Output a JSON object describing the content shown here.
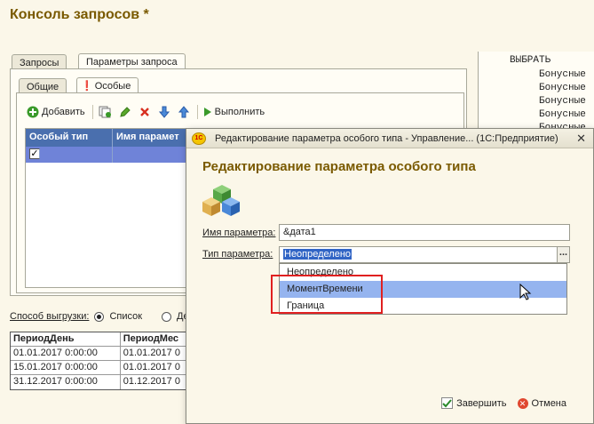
{
  "app": {
    "title": "Консоль запросов *"
  },
  "main_tabs": [
    {
      "label": "Запросы",
      "active": false
    },
    {
      "label": "Параметры запроса",
      "active": true
    }
  ],
  "sub_tabs": [
    {
      "label": "Общие",
      "active": false
    },
    {
      "label": "Особые",
      "active": true,
      "icon": "exclamation-icon"
    }
  ],
  "toolbar": {
    "add_label": "Добавить",
    "execute_label": "Выполнить",
    "icons": [
      "add-icon",
      "copy-icon",
      "edit-pencil-icon",
      "delete-icon",
      "move-down-icon",
      "move-up-icon",
      "play-icon"
    ]
  },
  "params_grid": {
    "columns": [
      "Особый тип",
      "Имя парамет"
    ],
    "rows": [
      {
        "special_type": true,
        "name": ""
      }
    ]
  },
  "code_panel": {
    "lines": [
      "ВЫБРАТЬ",
      "Бонусные",
      "Бонусные",
      "Бонусные",
      "Бонусные",
      "Бонусные"
    ]
  },
  "export": {
    "label": "Способ выгрузки:",
    "options": [
      {
        "label": "Список",
        "selected": true
      },
      {
        "label": "Де",
        "selected": false
      }
    ]
  },
  "results_table": {
    "columns": [
      "ПериодДень",
      "ПериодМес"
    ],
    "rows": [
      [
        "01.01.2017 0:00:00",
        "01.01.2017 0"
      ],
      [
        "15.01.2017 0:00:00",
        "01.01.2017 0"
      ],
      [
        "31.12.2017 0:00:00",
        "01.12.2017 0"
      ]
    ]
  },
  "dialog": {
    "window_title": "Редактирование параметра особого типа - Управление... (1С:Предприятие)",
    "logo_text": "1С",
    "heading": "Редактирование параметра особого типа",
    "param_name_label": "Имя параметра:",
    "param_name_value": "&дата1",
    "param_type_label": "Тип параметра:",
    "param_type_value": "Неопределено",
    "dots_label": "...",
    "dropdown_options": [
      "Неопределено",
      "МоментВремени",
      "Граница"
    ],
    "highlighted_option": "МоментВремени",
    "finish_label": "Завершить",
    "cancel_label": "Отмена"
  },
  "colors": {
    "title_brown": "#7a5a00",
    "grid_header": "#4a6fae",
    "grid_row_selected": "#6f83d8",
    "dropdown_highlight": "#95b4ef",
    "annotation_red": "#e02020"
  }
}
